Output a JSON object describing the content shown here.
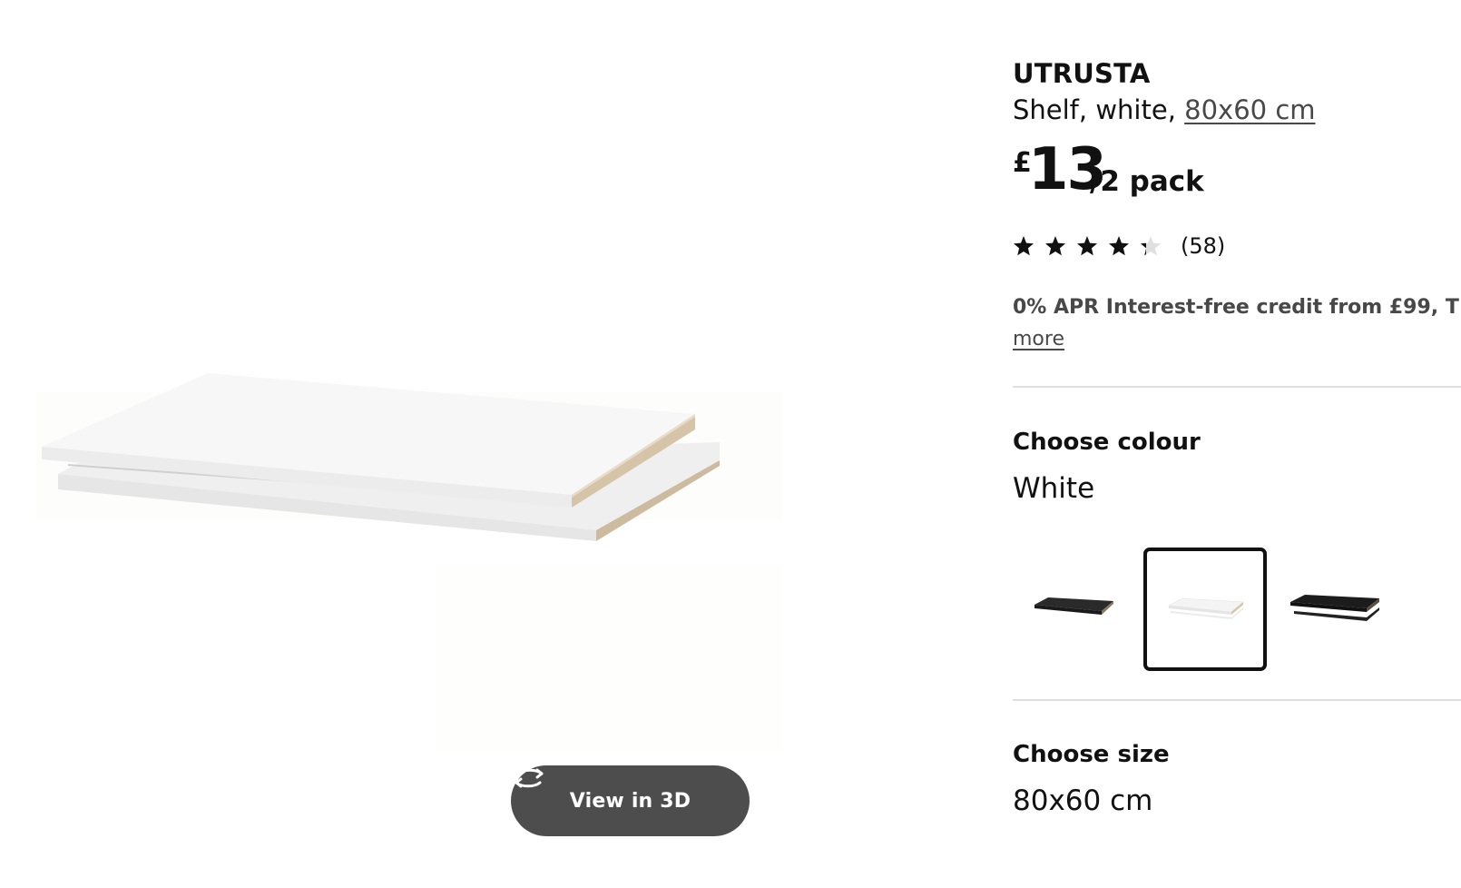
{
  "product": {
    "name": "UTRUSTA",
    "description_prefix": "Shelf, white, ",
    "size_link": "80x60 cm",
    "price": {
      "currency": "£",
      "amount": "13",
      "unit": "/2 pack"
    },
    "rating": {
      "stars": 4.5,
      "out_of": 5,
      "review_count": "(58)"
    },
    "credit_text": "0% APR Interest-free credit from £99, T",
    "credit_more": "more"
  },
  "gallery": {
    "view_3d_label": "View in 3D",
    "view_3d_icon": "rotate-3d-icon"
  },
  "colour": {
    "title": "Choose colour",
    "selected": "White",
    "options": [
      {
        "name": "black-brown shelf",
        "color": "#2a2a2a"
      },
      {
        "name": "white shelf",
        "color": "#f4f4f4",
        "selected": true
      },
      {
        "name": "black shelf",
        "color": "#1c1c1c"
      }
    ]
  },
  "size": {
    "title": "Choose size",
    "selected": "80x60 cm"
  },
  "colors": {
    "text": "#111111",
    "secondary_text": "#484848",
    "button_bg": "#4d4d4d",
    "divider": "#dfdfdf"
  }
}
